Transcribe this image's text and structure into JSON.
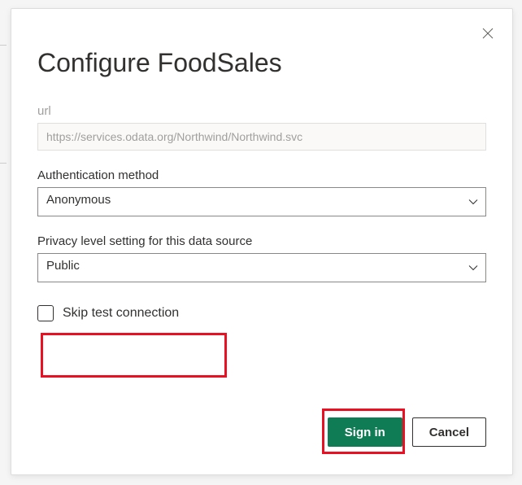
{
  "dialog": {
    "title": "Configure FoodSales",
    "url_label": "url",
    "url_value": "https://services.odata.org/Northwind/Northwind.svc",
    "auth_label": "Authentication method",
    "auth_value": "Anonymous",
    "privacy_label": "Privacy level setting for this data source",
    "privacy_value": "Public",
    "skip_test_label": "Skip test connection",
    "signin_label": "Sign in",
    "cancel_label": "Cancel"
  }
}
